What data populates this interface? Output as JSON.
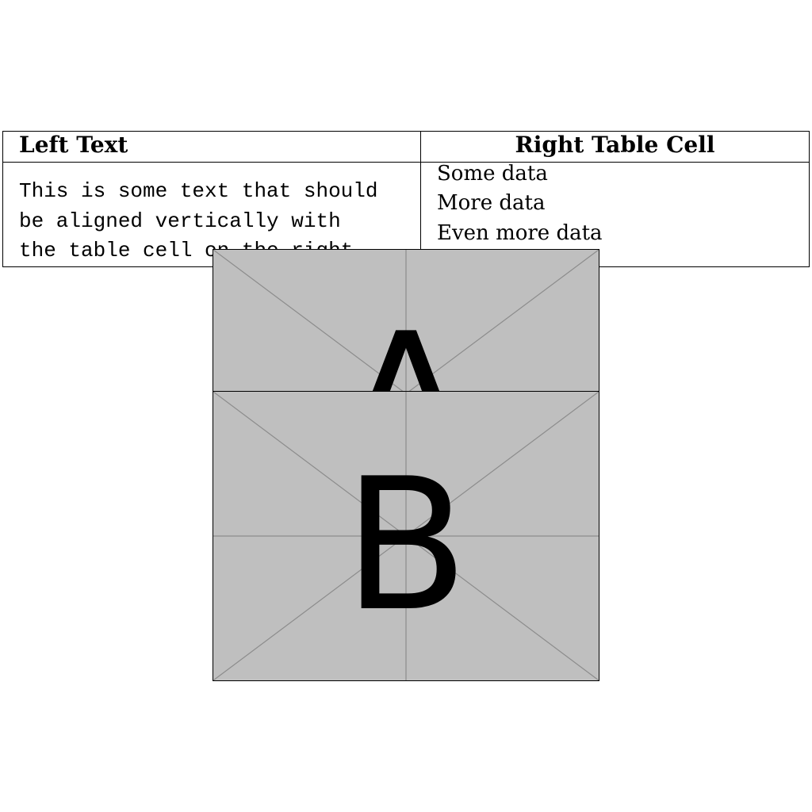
{
  "table": {
    "headers": {
      "left": "Left Text",
      "right": "Right Table Cell"
    },
    "left_cell_lines": [
      "This is some text that should",
      "be aligned vertically with",
      "the table cell on the right."
    ],
    "right_cell_lines": [
      "Some data",
      "More data",
      "Even more data"
    ]
  },
  "images": {
    "a_label": "A",
    "b_label": "B"
  },
  "colors": {
    "placeholder_fill": "#bfbfbf",
    "placeholder_lines": "#8c8c8c"
  }
}
